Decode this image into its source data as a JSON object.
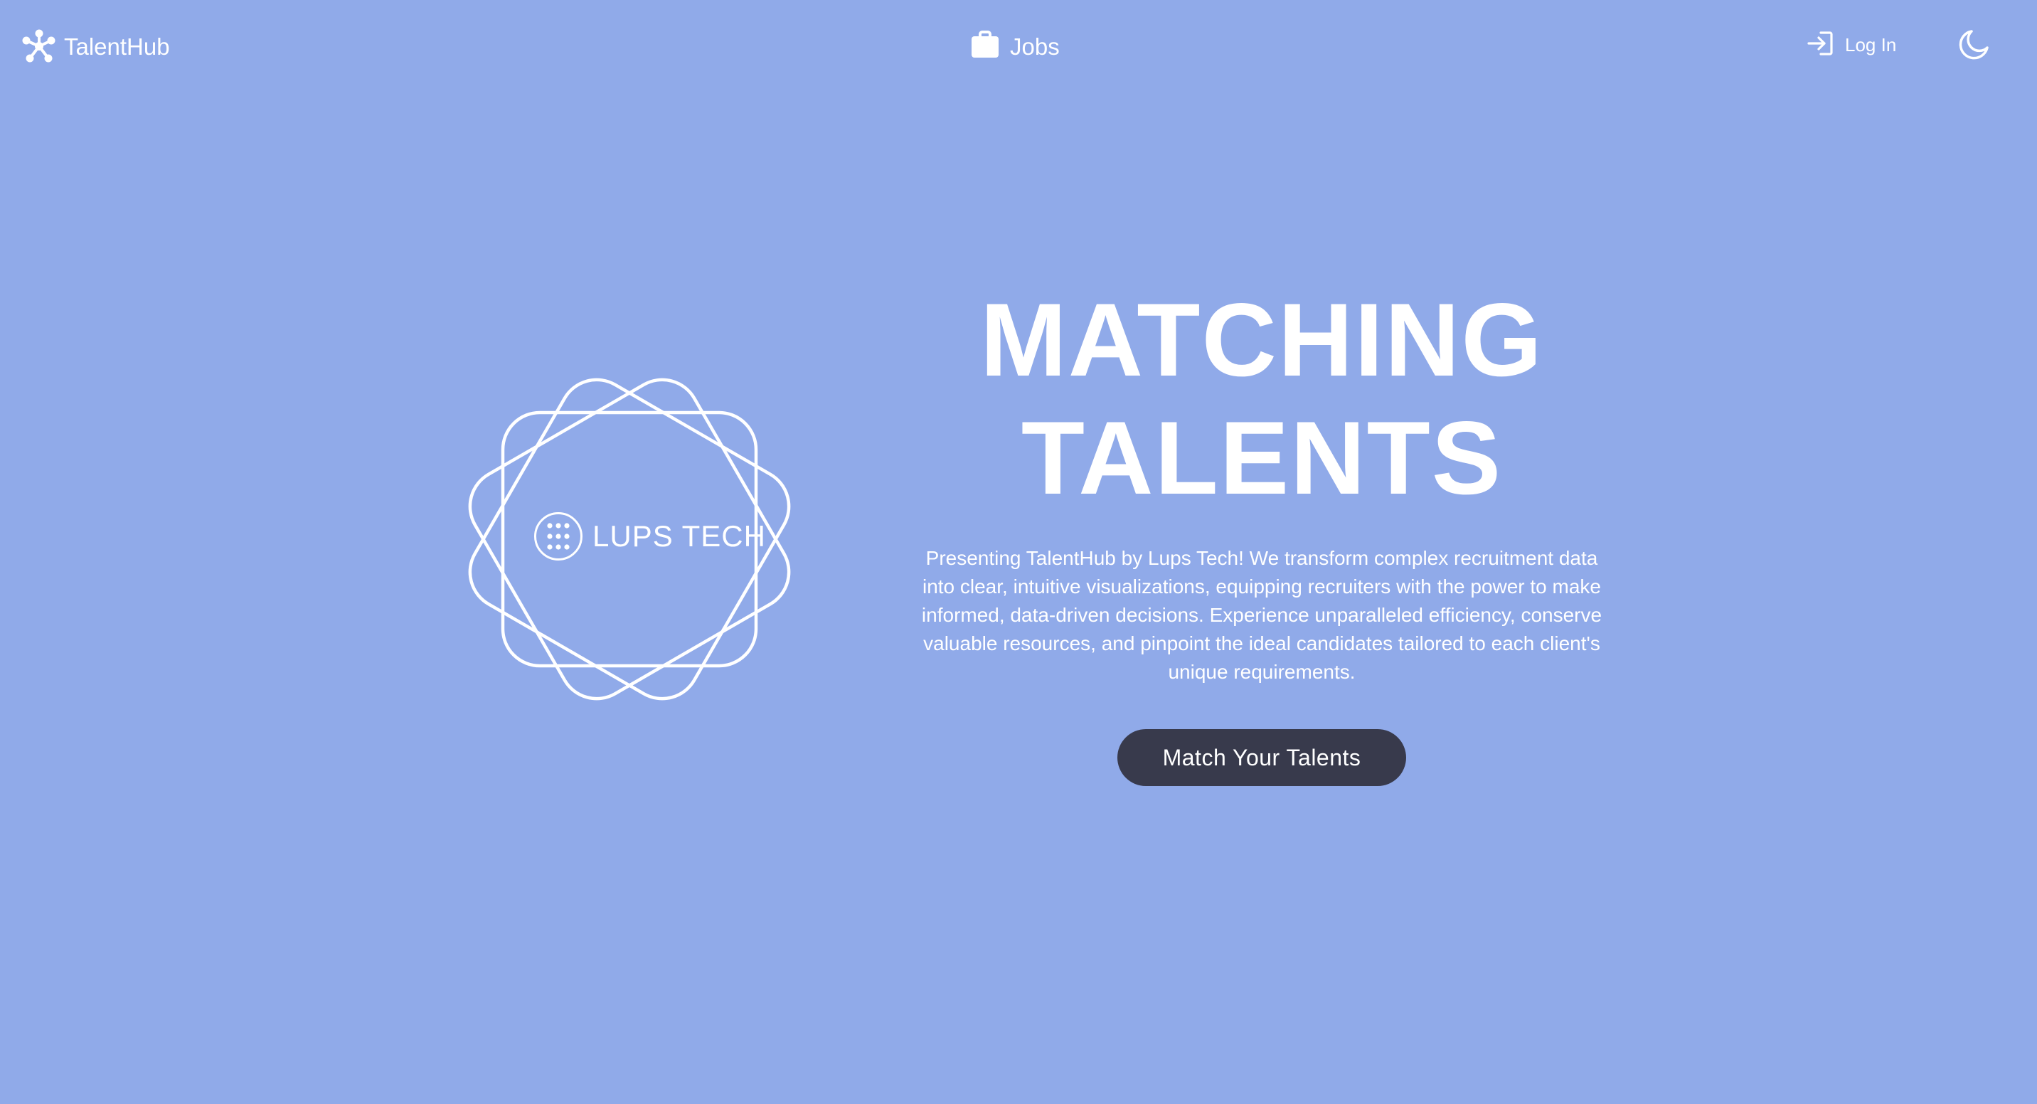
{
  "theme": {
    "background": "#90aae9",
    "text": "#ffffff",
    "button_bg": "#383a4c"
  },
  "navbar": {
    "brand": {
      "icon": "molecule-network-icon",
      "name": "TalentHub"
    },
    "jobs": {
      "icon": "briefcase-icon",
      "label": "Jobs"
    },
    "login": {
      "icon": "login-arrow-icon",
      "label": "Log In"
    },
    "theme_toggle": {
      "icon": "moon-icon"
    }
  },
  "hero": {
    "logo": {
      "icon": "lups-tech-dots-icon",
      "text": "LUPS TECH"
    },
    "title_line1": "MATCHING",
    "title_line2": "TALENTS",
    "description": "Presenting TalentHub by Lups Tech! We transform complex recruitment data into clear, intuitive visualizations, equipping recruiters with the power to make informed, data-driven decisions. Experience unparalleled efficiency, conserve valuable resources, and pinpoint the ideal candidates tailored to each client's unique requirements.",
    "cta_label": "Match Your Talents"
  }
}
